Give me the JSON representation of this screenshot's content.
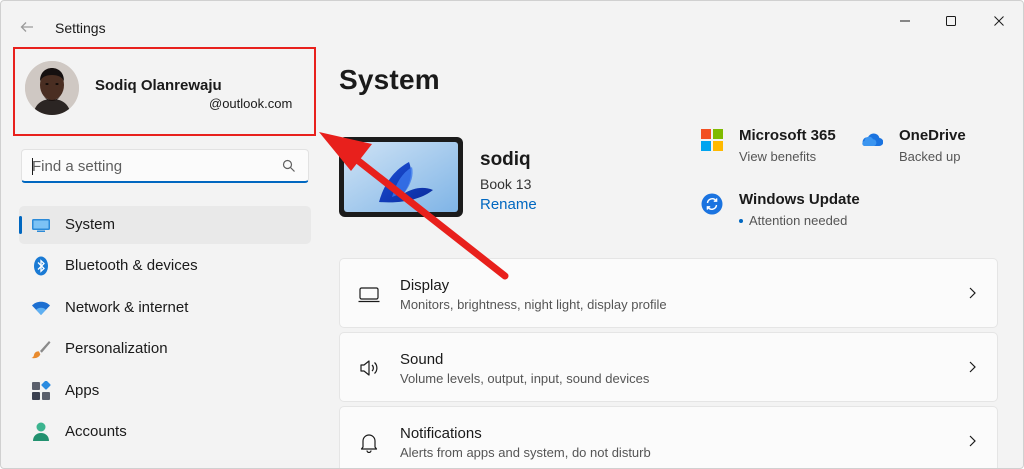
{
  "window": {
    "title": "Settings"
  },
  "profile": {
    "name": "Sodiq Olanrewaju",
    "email": "@outlook.com"
  },
  "search": {
    "placeholder": "Find a setting"
  },
  "nav": {
    "items": [
      {
        "label": "System",
        "icon": "system-icon",
        "selected": true
      },
      {
        "label": "Bluetooth & devices",
        "icon": "bluetooth-icon"
      },
      {
        "label": "Network & internet",
        "icon": "wifi-icon"
      },
      {
        "label": "Personalization",
        "icon": "brush-icon"
      },
      {
        "label": "Apps",
        "icon": "apps-icon"
      },
      {
        "label": "Accounts",
        "icon": "accounts-icon"
      }
    ]
  },
  "main": {
    "title": "System",
    "device": {
      "name": "sodiq",
      "model": "Book 13",
      "rename_label": "Rename"
    },
    "tiles": {
      "microsoft365": {
        "title": "Microsoft 365",
        "subtitle": "View benefits"
      },
      "onedrive": {
        "title": "OneDrive",
        "subtitle": "Backed up"
      },
      "windows_update": {
        "title": "Windows Update",
        "subtitle": "Attention needed"
      }
    },
    "cards": [
      {
        "title": "Display",
        "subtitle": "Monitors, brightness, night light, display profile",
        "icon": "display-icon"
      },
      {
        "title": "Sound",
        "subtitle": "Volume levels, output, input, sound devices",
        "icon": "speaker-icon"
      },
      {
        "title": "Notifications",
        "subtitle": "Alerts from apps and system, do not disturb",
        "icon": "bell-icon"
      }
    ]
  },
  "colors": {
    "accent": "#0067c0",
    "annotation": "#e8201c"
  }
}
